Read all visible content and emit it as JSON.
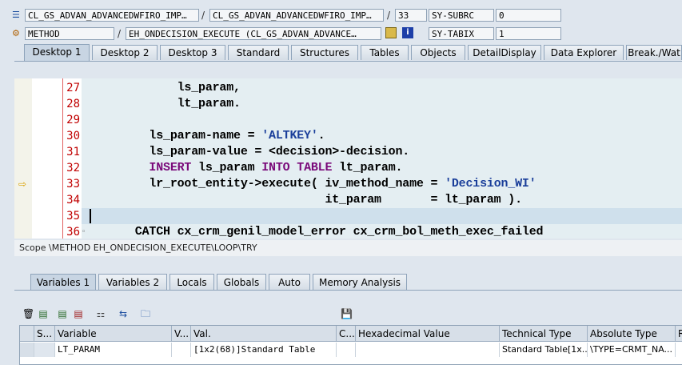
{
  "header": {
    "row1": {
      "program": "CL_GS_ADVAN_ADVANCEDWFIRO_IMP…",
      "include": "CL_GS_ADVAN_ADVANCEDWFIRO_IMP…",
      "line": "33",
      "sysvar_label": "SY-SUBRC",
      "sysvar_value": "0"
    },
    "row2": {
      "type": "METHOD",
      "event": "EH_ONDECISION_EXECUTE (CL_GS_ADVAN_ADVANCE…",
      "sysvar_label": "SY-TABIX",
      "sysvar_value": "1"
    }
  },
  "desktop_tabs": [
    "Desktop 1",
    "Desktop 2",
    "Desktop 3",
    "Standard",
    "Structures",
    "Tables",
    "Objects",
    "DetailDisplay",
    "Data Explorer",
    "Break./Wat"
  ],
  "editor": {
    "lines": [
      {
        "no": "27",
        "code": "            ls_param,"
      },
      {
        "no": "28",
        "code": "            lt_param."
      },
      {
        "no": "29",
        "code": ""
      },
      {
        "no": "30",
        "code": "        ls_param-name = 'ALTKEY'."
      },
      {
        "no": "31",
        "code": "        ls_param-value = <decision>-decision."
      },
      {
        "no": "32",
        "code": "        INSERT ls_param INTO TABLE lt_param."
      },
      {
        "no": "33",
        "code": "        lr_root_entity->execute( iv_method_name = 'Decision_WI'"
      },
      {
        "no": "34",
        "code": "                                 it_param       = lt_param )."
      },
      {
        "no": "35",
        "code": ""
      },
      {
        "no": "36",
        "code": "      CATCH cx_crm_genil_model_error cx_crm_bol_meth_exec_failed"
      }
    ],
    "current_line": "33"
  },
  "scope": "Scope \\METHOD EH_ONDECISION_EXECUTE\\LOOP\\TRY",
  "variable_tabs": [
    "Variables 1",
    "Variables 2",
    "Locals",
    "Globals",
    "Auto",
    "Memory Analysis"
  ],
  "grid": {
    "headers": [
      "S...",
      "Variable",
      "V...",
      "Val.",
      "C...",
      "Hexadecimal Value",
      "Technical Type",
      "Absolute Type",
      "R"
    ],
    "rows": [
      {
        "variable": "LT_PARAM",
        "value": "[1x2(68)]Standard Table",
        "technical": "Standard Table[1x...",
        "absolute": "\\TYPE=CRMT_NA..."
      }
    ]
  },
  "colors": {
    "accent": "#c8d5e3",
    "line_number": "#c00000",
    "keyword": "#7a0a7a",
    "string": "#1a3e9a"
  }
}
